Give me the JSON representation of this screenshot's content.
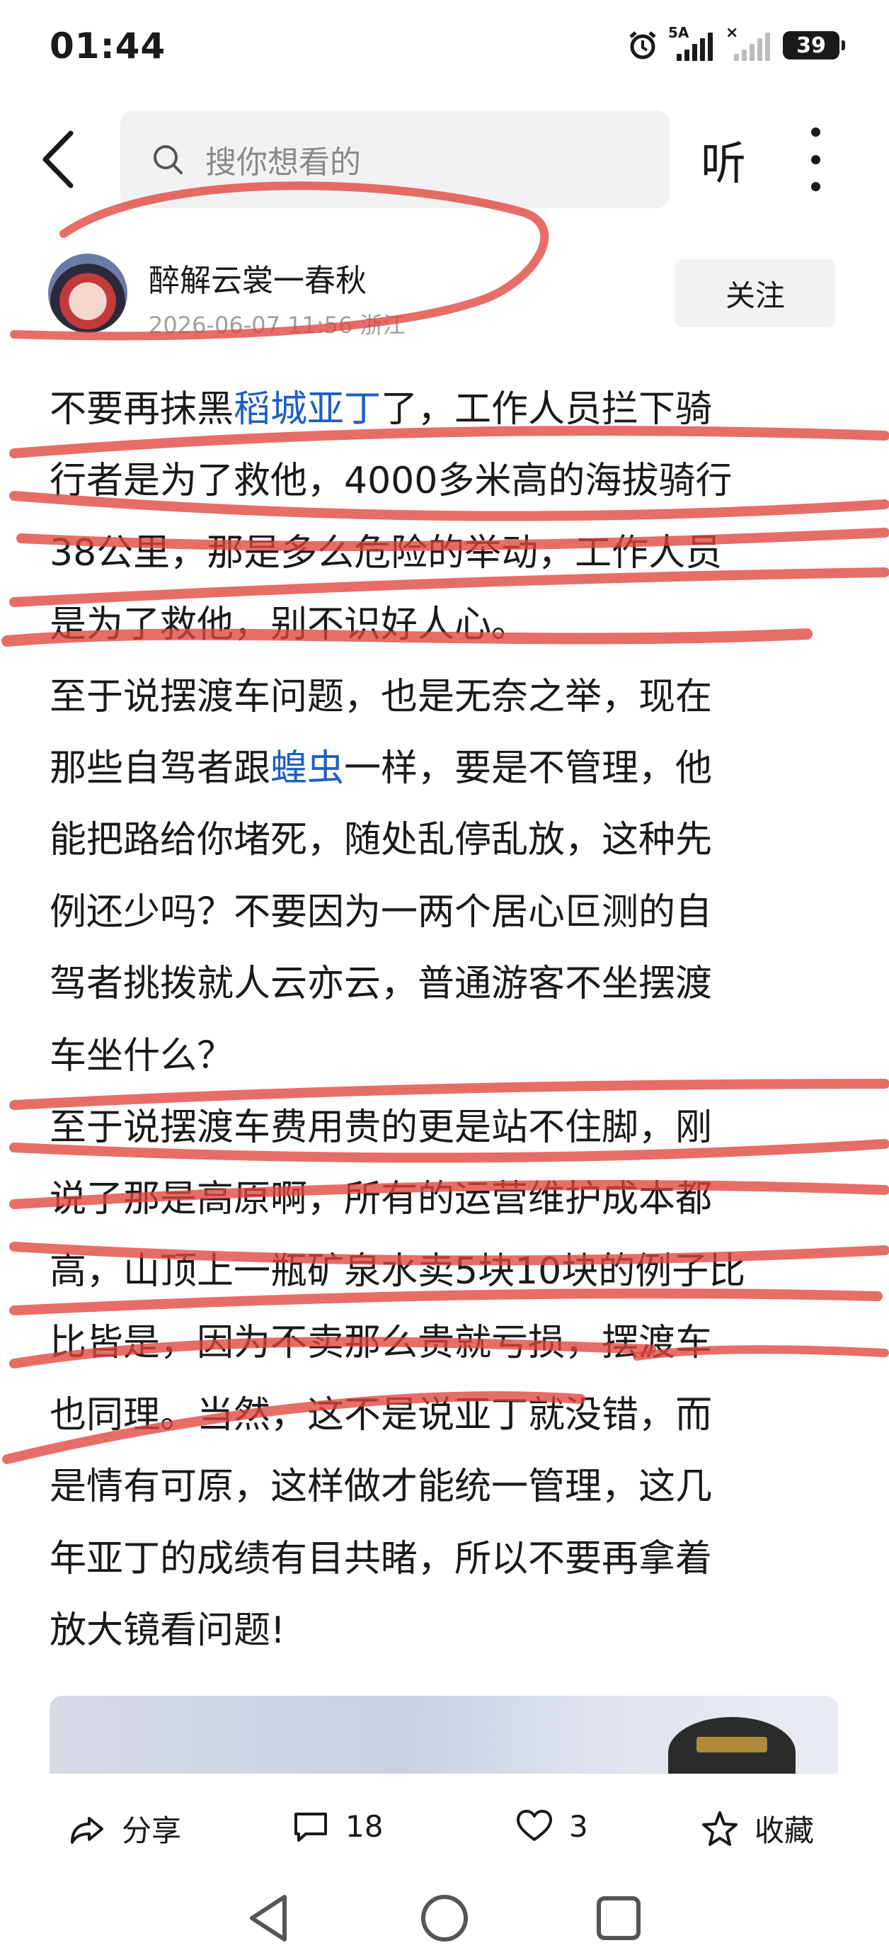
{
  "status_bar": {
    "time": "01:44",
    "network_label": "5A",
    "battery": "39"
  },
  "top_nav": {
    "search_placeholder": "搜你想看的",
    "listen_label": "听"
  },
  "author": {
    "name": "醉解云裳一春秋",
    "timestamp": "2026-06-07 11:56",
    "location": "浙江",
    "follow_label": "关注"
  },
  "article": {
    "lines": [
      {
        "parts": [
          "不要再抹黑",
          "稻城亚丁",
          "了，工作人员拦下骑"
        ]
      },
      {
        "parts": [
          "行者是为了救他，4000多米高的海拔骑行"
        ]
      },
      {
        "parts": [
          "38公里，那是多么危险的举动，工作人员"
        ]
      },
      {
        "parts": [
          "是为了救他，别不识好人心。"
        ]
      },
      {
        "parts": [
          "至于说摆渡车问题，也是无奈之举，现在"
        ]
      },
      {
        "parts": [
          "那些自驾者跟",
          "蝗虫",
          "一样，要是不管理，他"
        ]
      },
      {
        "parts": [
          "能把路给你堵死，随处乱停乱放，这种先"
        ]
      },
      {
        "parts": [
          "例还少吗？不要因为一两个居心叵测的自"
        ]
      },
      {
        "parts": [
          "驾者挑拨就人云亦云，普通游客不坐摆渡"
        ]
      },
      {
        "parts": [
          "车坐什么？"
        ]
      },
      {
        "parts": [
          "至于说摆渡车费用贵的更是站不住脚，刚"
        ]
      },
      {
        "parts": [
          "说了那是高原啊，所有的运营维护成本都"
        ]
      },
      {
        "parts": [
          "高，山顶上一瓶矿泉水卖5块10块的例子比"
        ]
      },
      {
        "parts": [
          "比皆是，因为不卖那么贵就亏损，摆渡车"
        ]
      },
      {
        "parts": [
          "也同理。当然，这不是说亚丁就没错，而"
        ]
      },
      {
        "parts": [
          "是情有可原，这样做才能统一管理，这几"
        ]
      },
      {
        "parts": [
          "年亚丁的成绩有目共睹，所以不要再拿着"
        ]
      },
      {
        "parts": [
          "放大镜看问题!"
        ]
      }
    ]
  },
  "actions": {
    "share_label": "分享",
    "comment_count": "18",
    "like_count": "3",
    "collect_label": "收藏"
  },
  "colors": {
    "link": "#1f5fc2",
    "annotation": "#e0453c",
    "search_bg": "#f2f2f2"
  }
}
